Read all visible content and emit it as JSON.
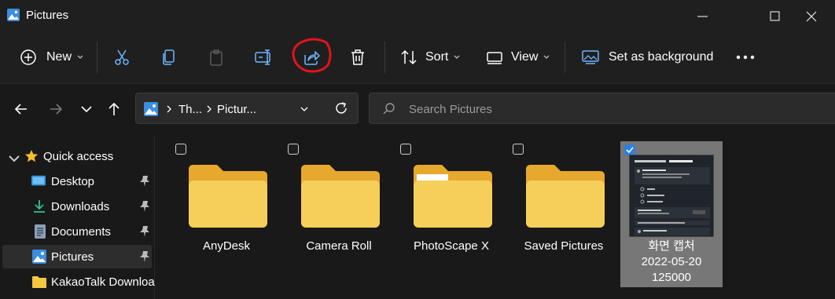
{
  "window": {
    "title": "Pictures"
  },
  "toolbar": {
    "new_label": "New",
    "sort_label": "Sort",
    "view_label": "View",
    "set_bg_label": "Set as background"
  },
  "address": {
    "crumb1": "Th...",
    "crumb2": "Pictur..."
  },
  "search": {
    "placeholder": "Search Pictures"
  },
  "sidebar": {
    "items": [
      {
        "label": "Quick access"
      },
      {
        "label": "Desktop"
      },
      {
        "label": "Downloads"
      },
      {
        "label": "Documents"
      },
      {
        "label": "Pictures"
      },
      {
        "label": "KakaoTalk Downloa"
      }
    ]
  },
  "files": [
    {
      "name": "AnyDesk"
    },
    {
      "name": "Camera Roll"
    },
    {
      "name": "PhotoScape X"
    },
    {
      "name": "Saved Pictures"
    },
    {
      "name_line1": "화면 캡처",
      "name_line2": "2022-05-20",
      "name_line3": "125000"
    }
  ],
  "colors": {
    "folder": "#f5c842",
    "accent": "#2f7fe0",
    "annotation": "#e0141e"
  }
}
